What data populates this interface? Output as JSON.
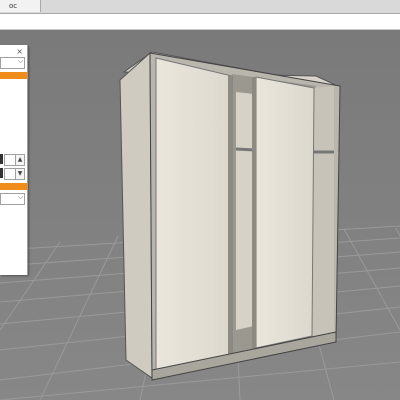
{
  "tabs": [
    {
      "label": "ос"
    }
  ],
  "panel": {
    "close_glyph": "×",
    "dropdown_chevron": "⌵",
    "spin_up": "▲",
    "spin_down": "▼"
  },
  "colors": {
    "accent": "#f08c1a",
    "background": "#7d7d7d",
    "panel": "#ffffff"
  },
  "icons": {
    "close": "close-icon",
    "dropdown": "chevron-down-icon"
  }
}
